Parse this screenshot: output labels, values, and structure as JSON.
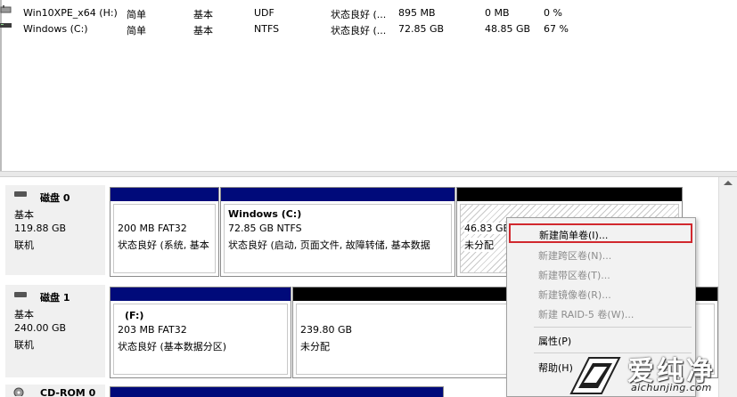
{
  "volumes": [
    {
      "name": "Win10XPE_x64 (H:)",
      "layout": "简单",
      "type": "基本",
      "fs": "UDF",
      "status": "状态良好 (...",
      "capacity": "895 MB",
      "free": "0 MB",
      "pct": "0 %",
      "icon": "cdrom-volume-icon"
    },
    {
      "name": "Windows (C:)",
      "layout": "简单",
      "type": "基本",
      "fs": "NTFS",
      "status": "状态良好 (...",
      "capacity": "72.85 GB",
      "free": "48.85 GB",
      "pct": "67 %",
      "icon": "disk-volume-icon"
    }
  ],
  "disks": [
    {
      "title": "磁盘 0",
      "type": "基本",
      "size": "119.88 GB",
      "state": "联机",
      "partitions": [
        {
          "name": "",
          "size": "200 MB FAT32",
          "status": "状态良好 (系统, 基本"
        },
        {
          "name": "Windows  (C:)",
          "size": "72.85 GB NTFS",
          "status": "状态良好 (启动, 页面文件, 故障转储, 基本数据"
        },
        {
          "name": "",
          "size": "46.83 GB",
          "status": "未分配"
        }
      ]
    },
    {
      "title": "磁盘 1",
      "type": "基本",
      "size": "240.00 GB",
      "state": "联机",
      "partitions": [
        {
          "name": "(F:)",
          "size": "203 MB FAT32",
          "status": "状态良好 (基本数据分区)"
        },
        {
          "name": "",
          "size": "239.80 GB",
          "status": "未分配"
        }
      ]
    },
    {
      "title": "CD-ROM 0"
    }
  ],
  "context_menu": {
    "items": [
      {
        "label": "新建简单卷(I)...",
        "enabled": true,
        "highlighted": true
      },
      {
        "label": "新建跨区卷(N)...",
        "enabled": false
      },
      {
        "label": "新建带区卷(T)...",
        "enabled": false
      },
      {
        "label": "新建镜像卷(R)...",
        "enabled": false
      },
      {
        "label": "新建 RAID-5 卷(W)...",
        "enabled": false
      },
      {
        "label": "属性(P)",
        "enabled": true
      },
      {
        "label": "帮助(H)",
        "enabled": true
      }
    ]
  },
  "watermark": {
    "brand": "爱纯净",
    "url": "aichunjing.com"
  },
  "colors": {
    "partition_bar": "#000a7a",
    "unallocated_bar": "#000000",
    "highlight_border": "#d1282e"
  }
}
